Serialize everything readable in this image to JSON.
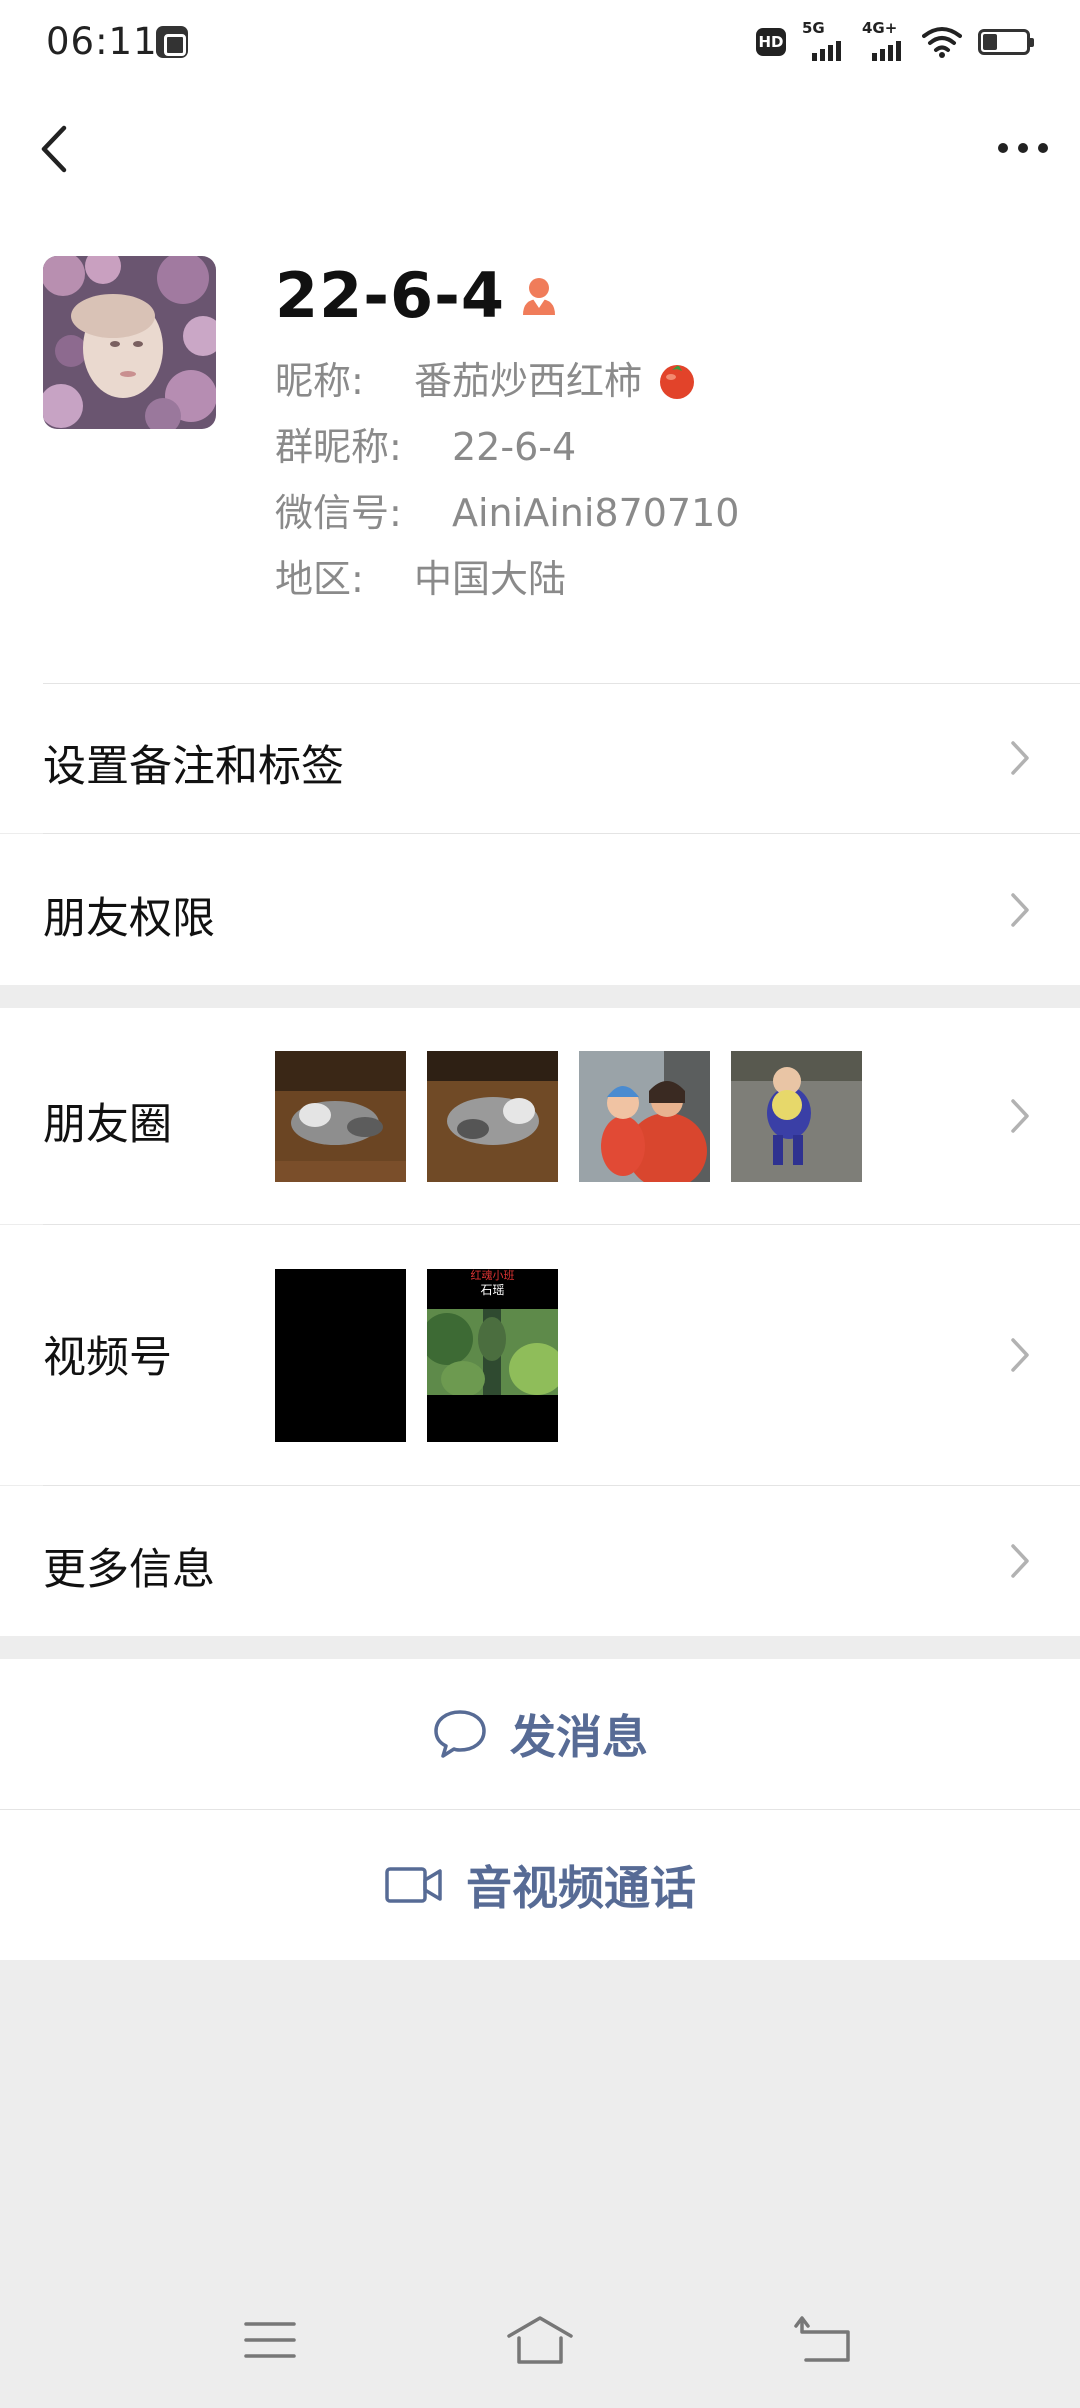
{
  "status_bar": {
    "time": "06:11",
    "hd_label": "HD",
    "network_1": "5G",
    "network_2": "4G+"
  },
  "profile": {
    "name": "22-6-4",
    "nickname_label": "昵称:",
    "nickname_value": "番茄炒西红柿",
    "group_nickname_label": "群昵称:",
    "group_nickname_value": "22-6-4",
    "wechat_id_label": "微信号:",
    "wechat_id_value": "AiniAini870710",
    "region_label": "地区:",
    "region_value": "中国大陆",
    "gender": "female"
  },
  "menu": {
    "remark_tags": "设置备注和标签",
    "friend_permissions": "朋友权限",
    "moments": "朋友圈",
    "channels": "视频号",
    "more_info": "更多信息"
  },
  "channels_thumb": {
    "caption_top": "红魂小班",
    "caption_sub": "石瑶"
  },
  "actions": {
    "send_message": "发消息",
    "av_call": "音视频通话"
  },
  "colors": {
    "link_blue": "#576b95",
    "background": "#ededed",
    "gender_female": "#f07c5a"
  },
  "icons": {
    "back": "chevron-left-icon",
    "more": "ellipsis-icon",
    "message": "chat-bubble-icon",
    "video_call": "video-camera-icon"
  }
}
